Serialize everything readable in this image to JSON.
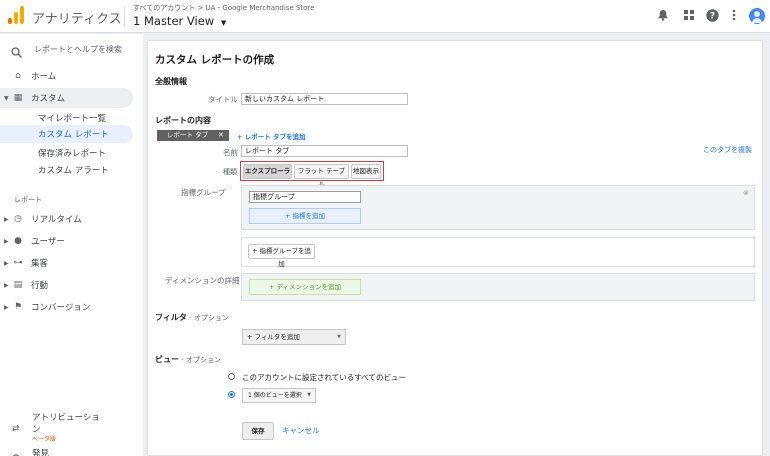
{
  "topbar": {
    "product": "アナリティクス",
    "breadcrumb": "すべてのアカウント > UA - Google Merchandise Store",
    "view": "1 Master View",
    "icons": [
      "bell-icon",
      "apps-icon",
      "help-icon",
      "more-icon",
      "avatar"
    ]
  },
  "sidebar": {
    "search_placeholder": "レポートとヘルプを検索",
    "home": "ホーム",
    "custom": "カスタム",
    "my_reports": "マイレポート一覧",
    "custom_reports": "カスタム レポート",
    "saved_reports": "保存済みレポート",
    "custom_alerts": "カスタム アラート",
    "reports_header": "レポート",
    "realtime": "リアルタイム",
    "users": "ユーザー",
    "acquisition": "集客",
    "behavior": "行動",
    "conversions": "コンバージョン",
    "attribution": "アトリビューション",
    "attribution_badge": "ベータ版",
    "discover": "発見"
  },
  "main": {
    "page_title": "カスタム レポートの作成",
    "general_info": "全般情報",
    "title_label": "タイトル",
    "title_value": "新しいカスタム レポート",
    "report_content": "レポートの内容",
    "report_tab": "レポート タブ",
    "add_report_tab": "+ レポート タブを追加",
    "name_label": "名前",
    "name_value": "レポート タブ",
    "duplicate_tab": "このタブを複製",
    "type_label": "種類",
    "types": [
      "エクスプローラ",
      "フラット テーブル",
      "地図表示"
    ],
    "metric_groups_label": "指標グループ",
    "metric_group_value": "指標グループ",
    "add_metric": "+ 指標を追加",
    "add_metric_group": "+ 指標グループを追加",
    "dimension_drilldowns": "ディメンションの詳細",
    "add_dimension": "+ ディメンションを追加",
    "filters": "フィルタ",
    "optional": " - オプション",
    "add_filter": "+ フィルタを追加",
    "views": "ビュー",
    "view_all": "このアカウントに設定されているすべてのビュー",
    "view_select": "1 個のビューを選択",
    "save": "保存",
    "cancel": "キャンセル"
  },
  "colors": {
    "accent": "#1a73e8",
    "highlight": "#e53935",
    "logo": [
      "#f9ab00",
      "#e37400"
    ]
  }
}
